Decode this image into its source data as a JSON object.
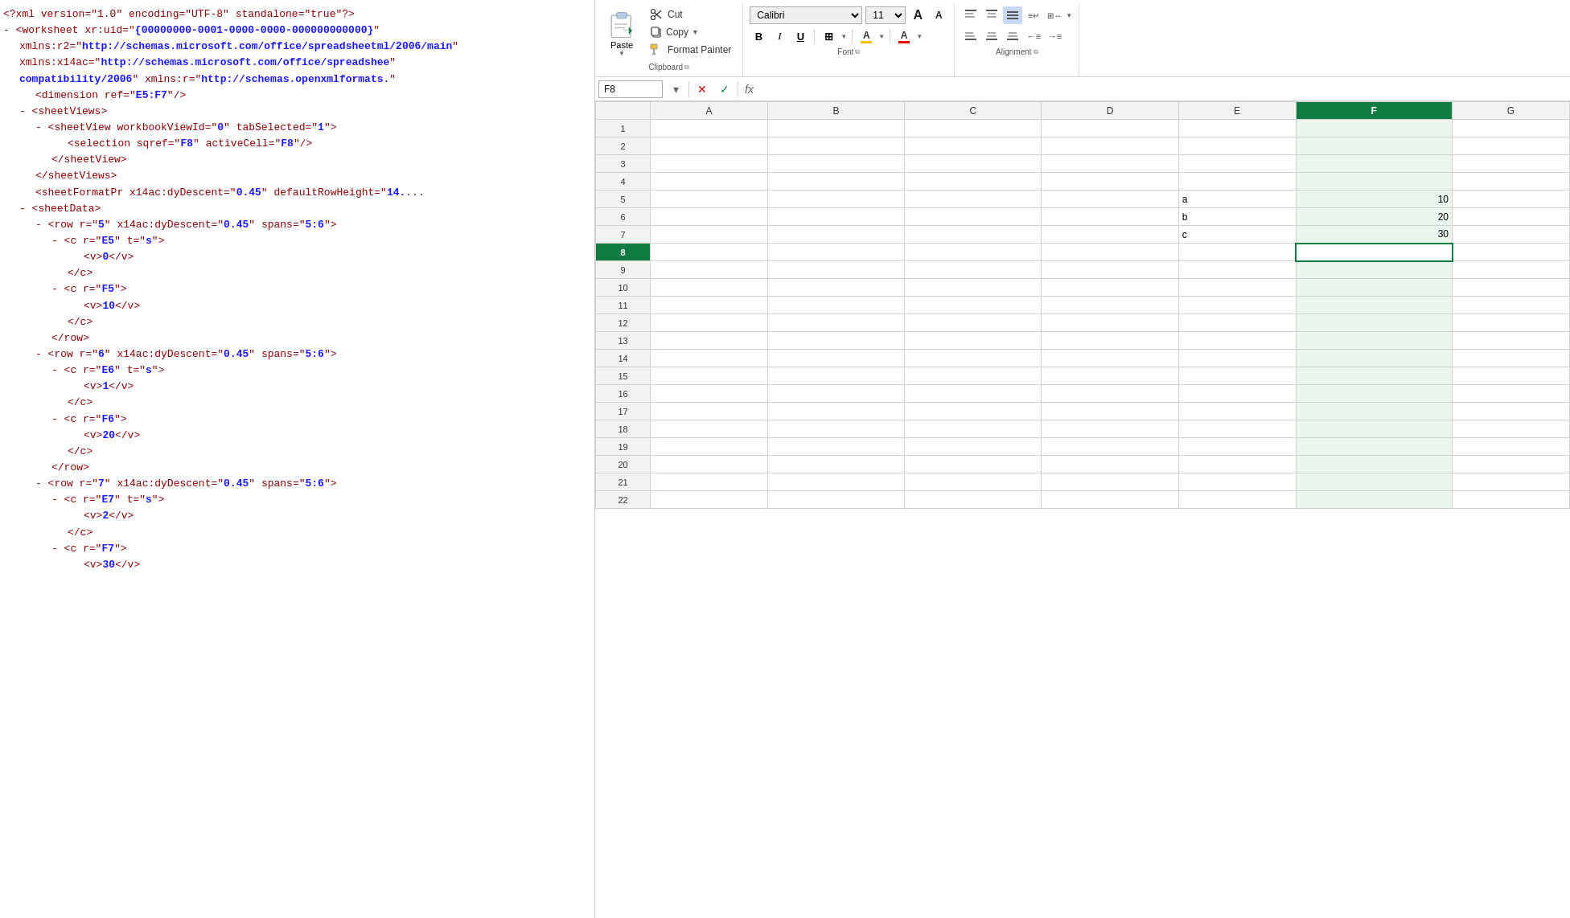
{
  "xml_panel": {
    "lines": [
      {
        "indent": 0,
        "bullet": false,
        "content": [
          {
            "type": "pi",
            "text": "<?xml version=\"1.0\" encoding=\"UTF-8\" standalone=\"true\"?>"
          }
        ]
      },
      {
        "indent": 0,
        "bullet": true,
        "content": [
          {
            "type": "tag",
            "text": "<worksheet xr:uid=\""
          },
          {
            "type": "attrval",
            "text": "{00000000-0001-0000-0000-000000000000}"
          },
          {
            "type": "tag",
            "text": "\""
          }
        ]
      },
      {
        "indent": 1,
        "bullet": false,
        "content": [
          {
            "type": "tag",
            "text": "xmlns:r2=\""
          },
          {
            "type": "attrval",
            "text": "http://schemas.microsoft.com/office/spreadsheetml/2006/main"
          },
          {
            "type": "tag",
            "text": "\""
          }
        ]
      },
      {
        "indent": 1,
        "bullet": false,
        "content": [
          {
            "type": "tag",
            "text": "xmlns:x14ac=\""
          },
          {
            "type": "attrval",
            "text": "http://schemas.microsoft.com/office/spreadshee"
          },
          {
            "type": "tag",
            "text": "\""
          }
        ]
      },
      {
        "indent": 1,
        "bullet": false,
        "content": [
          {
            "type": "attrval",
            "text": "compatibility/2006"
          },
          {
            "type": "tag",
            "text": "\" xmlns:r=\""
          },
          {
            "type": "attrval",
            "text": "http://schemas.openxmlformats."
          },
          {
            "type": "tag",
            "text": "\""
          }
        ]
      },
      {
        "indent": 2,
        "bullet": false,
        "content": [
          {
            "type": "tag",
            "text": "<dimension ref=\""
          },
          {
            "type": "attrval",
            "text": "E5:F7"
          },
          {
            "type": "tag",
            "text": "\"/>"
          }
        ]
      },
      {
        "indent": 1,
        "bullet": true,
        "content": [
          {
            "type": "tag",
            "text": "<sheetViews>"
          }
        ]
      },
      {
        "indent": 2,
        "bullet": true,
        "content": [
          {
            "type": "tag",
            "text": "<sheetView workbookViewId=\""
          },
          {
            "type": "attrval",
            "text": "0"
          },
          {
            "type": "tag",
            "text": "\" tabSelected=\""
          },
          {
            "type": "attrval",
            "text": "1"
          },
          {
            "type": "tag",
            "text": "\">"
          }
        ]
      },
      {
        "indent": 4,
        "bullet": false,
        "content": [
          {
            "type": "tag",
            "text": "<selection sqref=\""
          },
          {
            "type": "attrval",
            "text": "F8"
          },
          {
            "type": "tag",
            "text": "\" activeCell=\""
          },
          {
            "type": "attrval",
            "text": "F8"
          },
          {
            "type": "tag",
            "text": "\"/>"
          }
        ]
      },
      {
        "indent": 3,
        "bullet": false,
        "content": [
          {
            "type": "tag",
            "text": "</sheetView>"
          }
        ]
      },
      {
        "indent": 2,
        "bullet": false,
        "content": [
          {
            "type": "tag",
            "text": "</sheetViews>"
          }
        ]
      },
      {
        "indent": 2,
        "bullet": false,
        "content": [
          {
            "type": "tag",
            "text": "<sheetFormatPr x14ac:dyDescent=\""
          },
          {
            "type": "attrval",
            "text": "0.45"
          },
          {
            "type": "tag",
            "text": "\" defaultRowHeight=\""
          },
          {
            "type": "attrval",
            "text": "14."
          },
          {
            "type": "tag",
            "text": "..."
          }
        ]
      },
      {
        "indent": 1,
        "bullet": true,
        "content": [
          {
            "type": "tag",
            "text": "<sheetData>"
          }
        ]
      },
      {
        "indent": 2,
        "bullet": true,
        "content": [
          {
            "type": "tag",
            "text": "<row r=\""
          },
          {
            "type": "attrval",
            "text": "5"
          },
          {
            "type": "tag",
            "text": "\" x14ac:dyDescent=\""
          },
          {
            "type": "attrval",
            "text": "0.45"
          },
          {
            "type": "tag",
            "text": "\" spans=\""
          },
          {
            "type": "attrval",
            "text": "5:6"
          },
          {
            "type": "tag",
            "text": "\">"
          }
        ]
      },
      {
        "indent": 3,
        "bullet": true,
        "content": [
          {
            "type": "tag",
            "text": "<c r=\""
          },
          {
            "type": "attrval",
            "text": "E5"
          },
          {
            "type": "tag",
            "text": "\" t=\""
          },
          {
            "type": "attrval",
            "text": "s"
          },
          {
            "type": "tag",
            "text": "\">"
          }
        ]
      },
      {
        "indent": 5,
        "bullet": false,
        "content": [
          {
            "type": "tag",
            "text": "<v>"
          },
          {
            "type": "attrval",
            "text": "0"
          },
          {
            "type": "tag",
            "text": "</v>"
          }
        ]
      },
      {
        "indent": 4,
        "bullet": false,
        "content": [
          {
            "type": "tag",
            "text": "</c>"
          }
        ]
      },
      {
        "indent": 3,
        "bullet": true,
        "content": [
          {
            "type": "tag",
            "text": "<c r=\""
          },
          {
            "type": "attrval",
            "text": "F5"
          },
          {
            "type": "tag",
            "text": "\">"
          }
        ]
      },
      {
        "indent": 5,
        "bullet": false,
        "content": [
          {
            "type": "tag",
            "text": "<v>"
          },
          {
            "type": "attrval",
            "text": "10"
          },
          {
            "type": "tag",
            "text": "</v>"
          }
        ]
      },
      {
        "indent": 4,
        "bullet": false,
        "content": [
          {
            "type": "tag",
            "text": "</c>"
          }
        ]
      },
      {
        "indent": 3,
        "bullet": false,
        "content": [
          {
            "type": "tag",
            "text": "</row>"
          }
        ]
      },
      {
        "indent": 2,
        "bullet": true,
        "content": [
          {
            "type": "tag",
            "text": "<row r=\""
          },
          {
            "type": "attrval",
            "text": "6"
          },
          {
            "type": "tag",
            "text": "\" x14ac:dyDescent=\""
          },
          {
            "type": "attrval",
            "text": "0.45"
          },
          {
            "type": "tag",
            "text": "\" spans=\""
          },
          {
            "type": "attrval",
            "text": "5:6"
          },
          {
            "type": "tag",
            "text": "\">"
          }
        ]
      },
      {
        "indent": 3,
        "bullet": true,
        "content": [
          {
            "type": "tag",
            "text": "<c r=\""
          },
          {
            "type": "attrval",
            "text": "E6"
          },
          {
            "type": "tag",
            "text": "\" t=\""
          },
          {
            "type": "attrval",
            "text": "s"
          },
          {
            "type": "tag",
            "text": "\">"
          }
        ]
      },
      {
        "indent": 5,
        "bullet": false,
        "content": [
          {
            "type": "tag",
            "text": "<v>"
          },
          {
            "type": "attrval",
            "text": "1"
          },
          {
            "type": "tag",
            "text": "</v>"
          }
        ]
      },
      {
        "indent": 4,
        "bullet": false,
        "content": [
          {
            "type": "tag",
            "text": "</c>"
          }
        ]
      },
      {
        "indent": 3,
        "bullet": true,
        "content": [
          {
            "type": "tag",
            "text": "<c r=\""
          },
          {
            "type": "attrval",
            "text": "F6"
          },
          {
            "type": "tag",
            "text": "\">"
          }
        ]
      },
      {
        "indent": 5,
        "bullet": false,
        "content": [
          {
            "type": "tag",
            "text": "<v>"
          },
          {
            "type": "attrval",
            "text": "20"
          },
          {
            "type": "tag",
            "text": "</v>"
          }
        ]
      },
      {
        "indent": 4,
        "bullet": false,
        "content": [
          {
            "type": "tag",
            "text": "</c>"
          }
        ]
      },
      {
        "indent": 3,
        "bullet": false,
        "content": [
          {
            "type": "tag",
            "text": "</row>"
          }
        ]
      },
      {
        "indent": 2,
        "bullet": true,
        "content": [
          {
            "type": "tag",
            "text": "<row r=\""
          },
          {
            "type": "attrval",
            "text": "7"
          },
          {
            "type": "tag",
            "text": "\" x14ac:dyDescent=\""
          },
          {
            "type": "attrval",
            "text": "0.45"
          },
          {
            "type": "tag",
            "text": "\" spans=\""
          },
          {
            "type": "attrval",
            "text": "5:6"
          },
          {
            "type": "tag",
            "text": "\">"
          }
        ]
      },
      {
        "indent": 3,
        "bullet": true,
        "content": [
          {
            "type": "tag",
            "text": "<c r=\""
          },
          {
            "type": "attrval",
            "text": "E7"
          },
          {
            "type": "tag",
            "text": "\" t=\""
          },
          {
            "type": "attrval",
            "text": "s"
          },
          {
            "type": "tag",
            "text": "\">"
          }
        ]
      },
      {
        "indent": 5,
        "bullet": false,
        "content": [
          {
            "type": "tag",
            "text": "<v>"
          },
          {
            "type": "attrval",
            "text": "2"
          },
          {
            "type": "tag",
            "text": "</v>"
          }
        ]
      },
      {
        "indent": 4,
        "bullet": false,
        "content": [
          {
            "type": "tag",
            "text": "</c>"
          }
        ]
      },
      {
        "indent": 3,
        "bullet": true,
        "content": [
          {
            "type": "tag",
            "text": "<c r=\""
          },
          {
            "type": "attrval",
            "text": "F7"
          },
          {
            "type": "tag",
            "text": "\">"
          }
        ]
      },
      {
        "indent": 5,
        "bullet": false,
        "content": [
          {
            "type": "tag",
            "text": "<v>"
          },
          {
            "type": "attrval",
            "text": "30"
          },
          {
            "type": "tag",
            "text": "</v>"
          }
        ]
      }
    ]
  },
  "ribbon": {
    "clipboard_label": "Clipboard",
    "font_label": "Font",
    "alignment_label": "Alignment",
    "paste_label": "Paste",
    "cut_label": "Cut",
    "copy_label": "Copy",
    "format_painter_label": "Format Painter",
    "bold_label": "B",
    "italic_label": "I",
    "underline_label": "U",
    "font_name": "Calibri",
    "font_size": "11",
    "increase_font_label": "A↑",
    "decrease_font_label": "A↓",
    "align_top_left": "≡",
    "align_top_center": "≡",
    "align_top_right": "≡",
    "align_bottom_left": "≡",
    "align_bottom_center": "≡",
    "align_bottom_right": "≡"
  },
  "formula_bar": {
    "cell_ref": "F8",
    "formula_value": ""
  },
  "spreadsheet": {
    "columns": [
      "A",
      "B",
      "C",
      "D",
      "E",
      "F",
      "G"
    ],
    "active_column": "F",
    "active_row": 8,
    "active_cell": "F8",
    "rows": [
      {
        "num": 1,
        "cells": {
          "A": "",
          "B": "",
          "C": "",
          "D": "",
          "E": "",
          "F": "",
          "G": ""
        }
      },
      {
        "num": 2,
        "cells": {
          "A": "",
          "B": "",
          "C": "",
          "D": "",
          "E": "",
          "F": "",
          "G": ""
        }
      },
      {
        "num": 3,
        "cells": {
          "A": "",
          "B": "",
          "C": "",
          "D": "",
          "E": "",
          "F": "",
          "G": ""
        }
      },
      {
        "num": 4,
        "cells": {
          "A": "",
          "B": "",
          "C": "",
          "D": "",
          "E": "",
          "F": "",
          "G": ""
        }
      },
      {
        "num": 5,
        "cells": {
          "A": "",
          "B": "",
          "C": "",
          "D": "",
          "E": "a",
          "F": "10",
          "G": ""
        }
      },
      {
        "num": 6,
        "cells": {
          "A": "",
          "B": "",
          "C": "",
          "D": "",
          "E": "b",
          "F": "20",
          "G": ""
        }
      },
      {
        "num": 7,
        "cells": {
          "A": "",
          "B": "",
          "C": "",
          "D": "",
          "E": "c",
          "F": "30",
          "G": ""
        }
      },
      {
        "num": 8,
        "cells": {
          "A": "",
          "B": "",
          "C": "",
          "D": "",
          "E": "",
          "F": "",
          "G": ""
        }
      },
      {
        "num": 9,
        "cells": {
          "A": "",
          "B": "",
          "C": "",
          "D": "",
          "E": "",
          "F": "",
          "G": ""
        }
      },
      {
        "num": 10,
        "cells": {
          "A": "",
          "B": "",
          "C": "",
          "D": "",
          "E": "",
          "F": "",
          "G": ""
        }
      },
      {
        "num": 11,
        "cells": {
          "A": "",
          "B": "",
          "C": "",
          "D": "",
          "E": "",
          "F": "",
          "G": ""
        }
      },
      {
        "num": 12,
        "cells": {
          "A": "",
          "B": "",
          "C": "",
          "D": "",
          "E": "",
          "F": "",
          "G": ""
        }
      },
      {
        "num": 13,
        "cells": {
          "A": "",
          "B": "",
          "C": "",
          "D": "",
          "E": "",
          "F": "",
          "G": ""
        }
      },
      {
        "num": 14,
        "cells": {
          "A": "",
          "B": "",
          "C": "",
          "D": "",
          "E": "",
          "F": "",
          "G": ""
        }
      },
      {
        "num": 15,
        "cells": {
          "A": "",
          "B": "",
          "C": "",
          "D": "",
          "E": "",
          "F": "",
          "G": ""
        }
      },
      {
        "num": 16,
        "cells": {
          "A": "",
          "B": "",
          "C": "",
          "D": "",
          "E": "",
          "F": "",
          "G": ""
        }
      },
      {
        "num": 17,
        "cells": {
          "A": "",
          "B": "",
          "C": "",
          "D": "",
          "E": "",
          "F": "",
          "G": ""
        }
      },
      {
        "num": 18,
        "cells": {
          "A": "",
          "B": "",
          "C": "",
          "D": "",
          "E": "",
          "F": "",
          "G": ""
        }
      },
      {
        "num": 19,
        "cells": {
          "A": "",
          "B": "",
          "C": "",
          "D": "",
          "E": "",
          "F": "",
          "G": ""
        }
      },
      {
        "num": 20,
        "cells": {
          "A": "",
          "B": "",
          "C": "",
          "D": "",
          "E": "",
          "F": "",
          "G": ""
        }
      },
      {
        "num": 21,
        "cells": {
          "A": "",
          "B": "",
          "C": "",
          "D": "",
          "E": "",
          "F": "",
          "G": ""
        }
      },
      {
        "num": 22,
        "cells": {
          "A": "",
          "B": "",
          "C": "",
          "D": "",
          "E": "",
          "F": "",
          "G": ""
        }
      }
    ],
    "numeric_cells": [
      "F5",
      "F6",
      "F7"
    ]
  }
}
